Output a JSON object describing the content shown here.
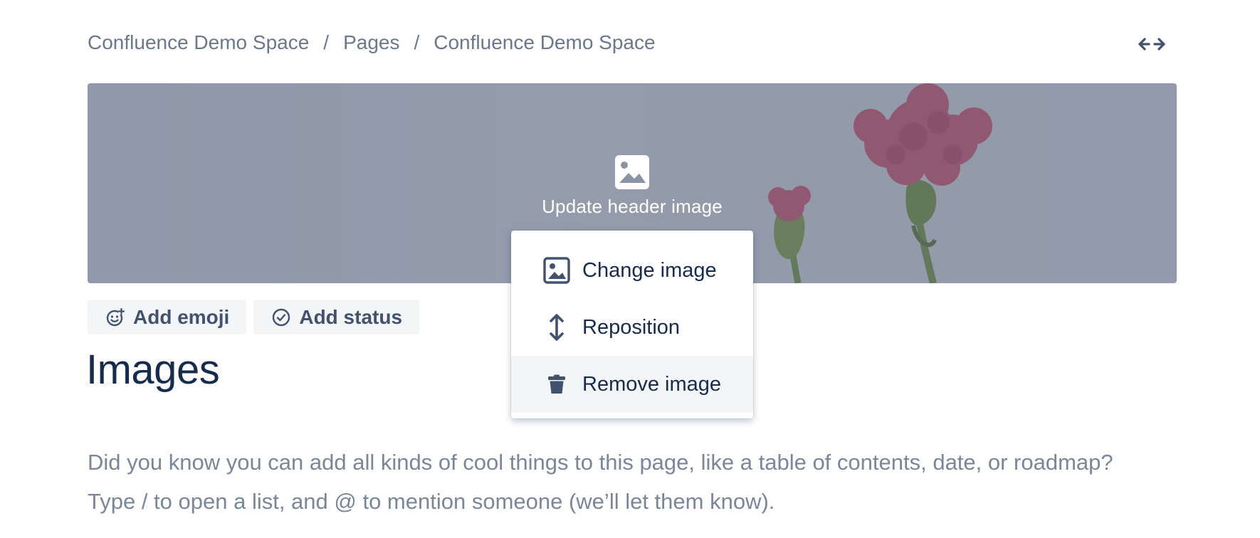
{
  "breadcrumb": {
    "items": [
      "Confluence Demo Space",
      "Pages",
      "Confluence Demo Space"
    ],
    "separator": "/"
  },
  "toolbar": {
    "width_toggle_icon": "expand-width-icon"
  },
  "header_image": {
    "update_label": "Update header image",
    "icon": "image-icon",
    "overlay_color": "#505c76"
  },
  "menu": {
    "items": [
      {
        "label": "Change image",
        "icon": "image-icon"
      },
      {
        "label": "Reposition",
        "icon": "vertical-arrows-icon"
      },
      {
        "label": "Remove image",
        "icon": "trash-icon"
      }
    ]
  },
  "meta_buttons": {
    "emoji_label": "Add emoji",
    "status_label": "Add status"
  },
  "page": {
    "title": "Images",
    "body_lines": [
      "Did you know you can add all kinds of cool things to this page, like a table of contents, date, or roadmap?",
      "Type / to open a list, and @ to mention someone (we’ll let them know)."
    ]
  },
  "colors": {
    "text_primary": "#172b4d",
    "text_muted": "#6b778c",
    "button_bg": "#f4f5f7",
    "flower": "#d9435a",
    "stem": "#6f8a2c"
  }
}
